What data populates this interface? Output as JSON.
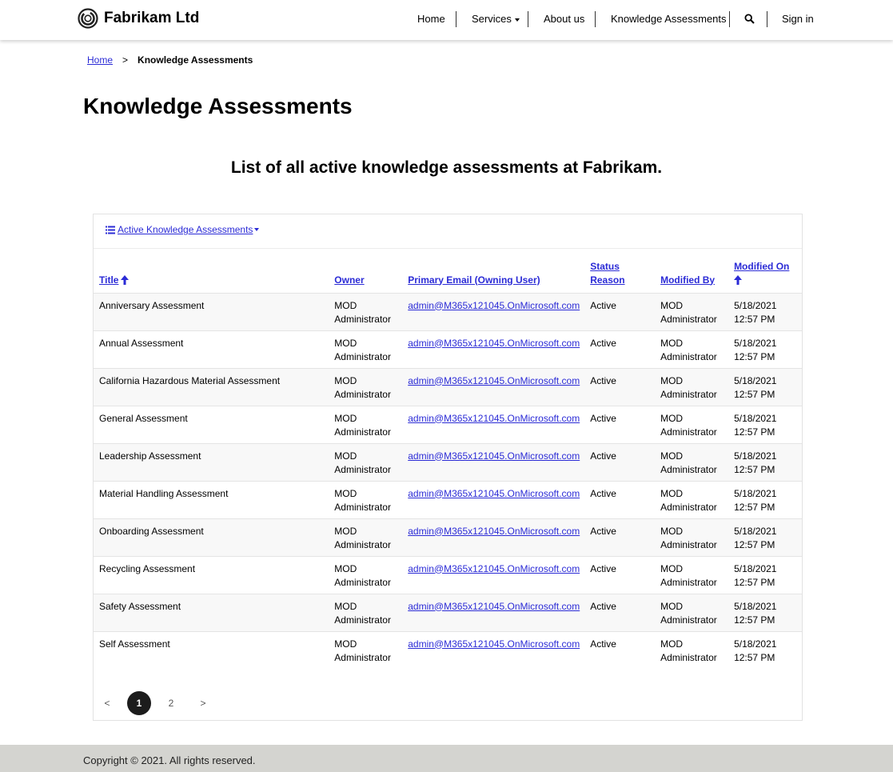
{
  "brand": {
    "name": "Fabrikam Ltd"
  },
  "nav": {
    "home": "Home",
    "services": "Services",
    "about": "About us",
    "knowledge": "Knowledge Assessments",
    "sign_in": "Sign in"
  },
  "breadcrumb": {
    "home": "Home",
    "separator": ">",
    "current": "Knowledge Assessments"
  },
  "page": {
    "title": "Knowledge Assessments",
    "subtitle": "List of all active knowledge assessments at Fabrikam."
  },
  "list": {
    "view_label": "Active Knowledge Assessments",
    "columns": {
      "title": "Title",
      "owner": "Owner",
      "email": "Primary Email (Owning User)",
      "status_line1": "Status",
      "status_line2": "Reason",
      "modified_by": "Modified By",
      "modified_on": "Modified On"
    },
    "rows": [
      {
        "title": "Anniversary Assessment",
        "owner1": "MOD",
        "owner2": "Administrator",
        "email": "admin@M365x121045.OnMicrosoft.com",
        "status": "Active",
        "modby1": "MOD",
        "modby2": "Administrator",
        "date": "5/18/2021",
        "time": "12:57 PM"
      },
      {
        "title": "Annual Assessment",
        "owner1": "MOD",
        "owner2": "Administrator",
        "email": "admin@M365x121045.OnMicrosoft.com",
        "status": "Active",
        "modby1": "MOD",
        "modby2": "Administrator",
        "date": "5/18/2021",
        "time": "12:57 PM"
      },
      {
        "title": "California Hazardous Material Assessment",
        "owner1": "MOD",
        "owner2": "Administrator",
        "email": "admin@M365x121045.OnMicrosoft.com",
        "status": "Active",
        "modby1": "MOD",
        "modby2": "Administrator",
        "date": "5/18/2021",
        "time": "12:57 PM"
      },
      {
        "title": "General Assessment",
        "owner1": "MOD",
        "owner2": "Administrator",
        "email": "admin@M365x121045.OnMicrosoft.com",
        "status": "Active",
        "modby1": "MOD",
        "modby2": "Administrator",
        "date": "5/18/2021",
        "time": "12:57 PM"
      },
      {
        "title": "Leadership Assessment",
        "owner1": "MOD",
        "owner2": "Administrator",
        "email": "admin@M365x121045.OnMicrosoft.com",
        "status": "Active",
        "modby1": "MOD",
        "modby2": "Administrator",
        "date": "5/18/2021",
        "time": "12:57 PM"
      },
      {
        "title": "Material Handling Assessment",
        "owner1": "MOD",
        "owner2": "Administrator",
        "email": "admin@M365x121045.OnMicrosoft.com",
        "status": "Active",
        "modby1": "MOD",
        "modby2": "Administrator",
        "date": "5/18/2021",
        "time": "12:57 PM"
      },
      {
        "title": "Onboarding Assessment",
        "owner1": "MOD",
        "owner2": "Administrator",
        "email": "admin@M365x121045.OnMicrosoft.com",
        "status": "Active",
        "modby1": "MOD",
        "modby2": "Administrator",
        "date": "5/18/2021",
        "time": "12:57 PM"
      },
      {
        "title": "Recycling Assessment",
        "owner1": "MOD",
        "owner2": "Administrator",
        "email": "admin@M365x121045.OnMicrosoft.com",
        "status": "Active",
        "modby1": "MOD",
        "modby2": "Administrator",
        "date": "5/18/2021",
        "time": "12:57 PM"
      },
      {
        "title": "Safety Assessment",
        "owner1": "MOD",
        "owner2": "Administrator",
        "email": "admin@M365x121045.OnMicrosoft.com",
        "status": "Active",
        "modby1": "MOD",
        "modby2": "Administrator",
        "date": "5/18/2021",
        "time": "12:57 PM"
      },
      {
        "title": "Self Assessment",
        "owner1": "MOD",
        "owner2": "Administrator",
        "email": "admin@M365x121045.OnMicrosoft.com",
        "status": "Active",
        "modby1": "MOD",
        "modby2": "Administrator",
        "date": "5/18/2021",
        "time": "12:57 PM"
      }
    ]
  },
  "pagination": {
    "prev": "<",
    "page1": "1",
    "page2": "2",
    "next": ">",
    "current_page": 1
  },
  "footer": {
    "copyright": "Copyright © 2021. All rights reserved."
  },
  "icons": {
    "logo": "circular-logo-icon",
    "services_caret": "caret-down-icon",
    "search": "search-icon",
    "view_list": "list-icon",
    "view_caret": "caret-down-icon",
    "sort_asc": "arrow-up-icon"
  },
  "colors": {
    "link": "#2b2bd6",
    "footer_bg": "#d4d4d0",
    "active_page": "#1c1c1c"
  }
}
